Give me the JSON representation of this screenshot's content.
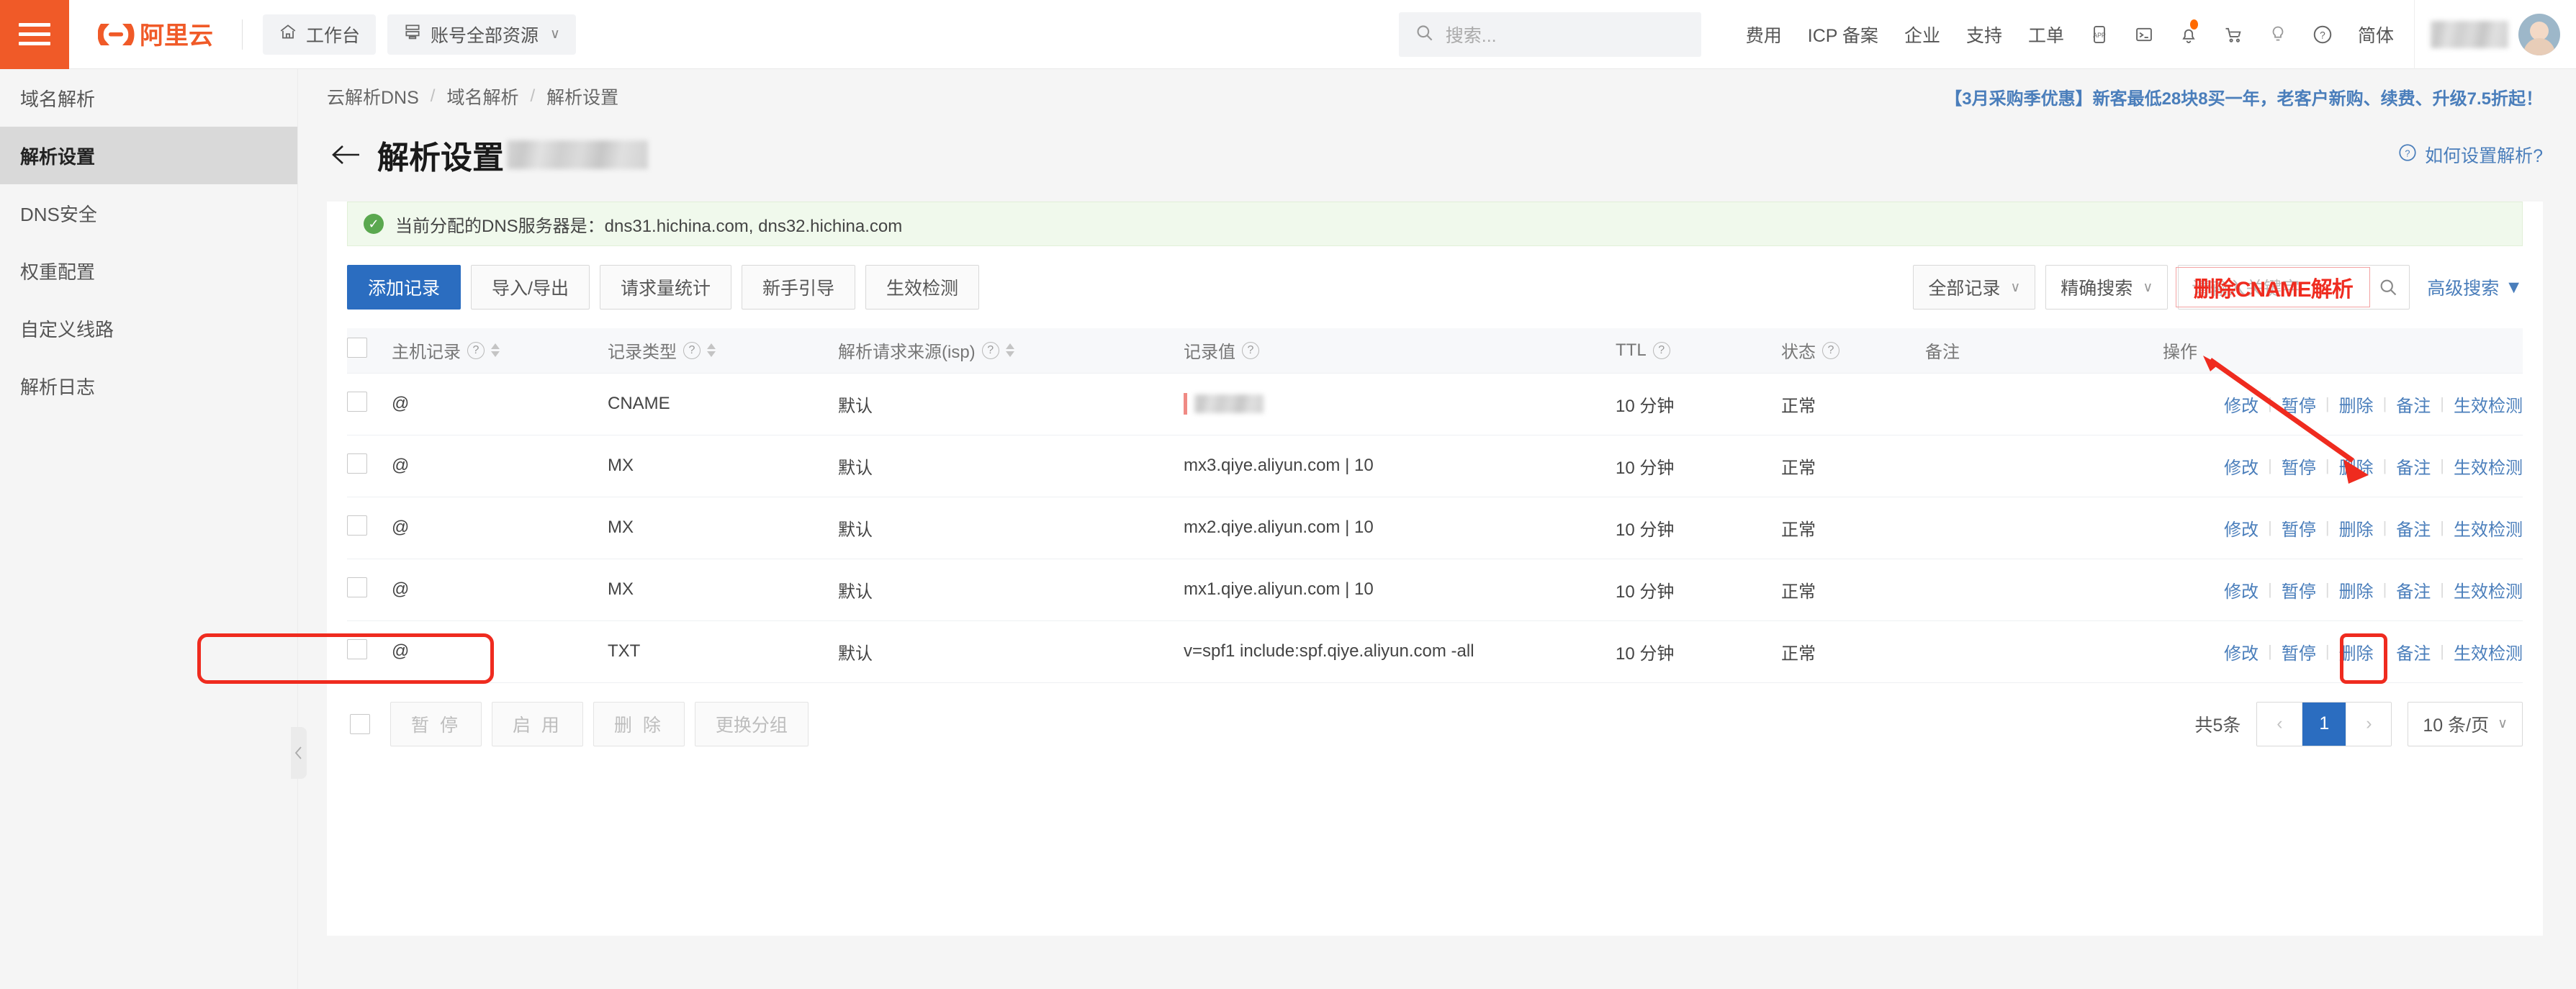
{
  "colors": {
    "brand_orange": "#f05a28",
    "primary_blue": "#2b6dc0",
    "link_blue": "#4a7ebb",
    "annotation_red": "#ef2b1f",
    "status_green": "#4caf50",
    "notice_bg": "#f0f9ec"
  },
  "header": {
    "menu_icon": "hamburger-icon",
    "logo_text": "阿里云",
    "workbench": {
      "label": "工作台",
      "icon": "home-icon"
    },
    "resources": {
      "label": "账号全部资源",
      "icon": "grid-icon",
      "caret": "∨"
    },
    "search": {
      "placeholder": "搜索...",
      "icon": "search-icon"
    },
    "links": [
      "费用",
      "ICP 备案",
      "企业",
      "支持",
      "工单"
    ],
    "icons": [
      "app-icon",
      "terminal-icon",
      "bell-icon",
      "cart-icon",
      "lightbulb-icon",
      "question-icon"
    ],
    "lang": "简体",
    "account_name_redacted": true
  },
  "sidebar": {
    "items": [
      {
        "label": "域名解析",
        "active": false
      },
      {
        "label": "解析设置",
        "active": true
      },
      {
        "label": "DNS安全",
        "active": false
      },
      {
        "label": "权重配置",
        "active": false
      },
      {
        "label": "自定义线路",
        "active": false
      },
      {
        "label": "解析日志",
        "active": false
      }
    ],
    "collapse_icon": "chevron-left-icon"
  },
  "breadcrumb": {
    "items": [
      "云解析DNS",
      "域名解析",
      "解析设置"
    ],
    "separator": "/"
  },
  "promo": "【3月采购季优惠】新客最低28块8买一年，老客户新购、续费、升级7.5折起！",
  "page": {
    "back_icon": "arrow-left-icon",
    "title": "解析设置",
    "title_domain_redacted": true,
    "help_link": {
      "label": "如何设置解析?",
      "icon": "question-circle-icon"
    }
  },
  "notice": {
    "icon": "check-circle-icon",
    "text": "当前分配的DNS服务器是：dns31.hichina.com, dns32.hichina.com"
  },
  "toolbar": {
    "add_record": "添加记录",
    "import_export": "导入/导出",
    "request_stats": "请求量统计",
    "beginner_guide": "新手引导",
    "effect_check": "生效检测",
    "filter_type": {
      "label": "全部记录",
      "caret": "∨"
    },
    "filter_match": {
      "label": "精确搜索",
      "caret": "∨"
    },
    "search": {
      "placeholder": "请输入关键字",
      "value": "",
      "icon": "search-icon"
    },
    "advanced_search": {
      "label": "高级搜索",
      "caret": "▼"
    }
  },
  "annotations": {
    "search_note": "删除CNAME解析",
    "arrow": "red-arrow-pointing-to-delete-link",
    "highlight_row": "row-1 host-and-type",
    "highlight_action": "row-1 delete-link"
  },
  "table": {
    "columns": [
      {
        "label": "主机记录",
        "help": true,
        "sortable": true
      },
      {
        "label": "记录类型",
        "help": true,
        "sortable": true
      },
      {
        "label": "解析请求来源(isp)",
        "help": true,
        "sortable": true
      },
      {
        "label": "记录值",
        "help": true,
        "sortable": false
      },
      {
        "label": "TTL",
        "help": true,
        "sortable": false
      },
      {
        "label": "状态",
        "help": true,
        "sortable": false
      },
      {
        "label": "备注",
        "help": false,
        "sortable": false
      },
      {
        "label": "操作",
        "help": false,
        "sortable": false
      }
    ],
    "row_actions": [
      "修改",
      "暂停",
      "删除",
      "备注",
      "生效检测"
    ],
    "rows": [
      {
        "host": "@",
        "type": "CNAME",
        "isp": "默认",
        "value": "",
        "value_redacted": true,
        "ttl": "10 分钟",
        "status": "正常",
        "remark": ""
      },
      {
        "host": "@",
        "type": "MX",
        "isp": "默认",
        "value": "mx3.qiye.aliyun.com | 10",
        "value_redacted": false,
        "ttl": "10 分钟",
        "status": "正常",
        "remark": ""
      },
      {
        "host": "@",
        "type": "MX",
        "isp": "默认",
        "value": "mx2.qiye.aliyun.com | 10",
        "value_redacted": false,
        "ttl": "10 分钟",
        "status": "正常",
        "remark": ""
      },
      {
        "host": "@",
        "type": "MX",
        "isp": "默认",
        "value": "mx1.qiye.aliyun.com | 10",
        "value_redacted": false,
        "ttl": "10 分钟",
        "status": "正常",
        "remark": ""
      },
      {
        "host": "@",
        "type": "TXT",
        "isp": "默认",
        "value": "v=spf1 include:spf.qiye.aliyun.com -all",
        "value_redacted": false,
        "ttl": "10 分钟",
        "status": "正常",
        "remark": ""
      }
    ]
  },
  "footer": {
    "bulk": [
      "暂 停",
      "启 用",
      "删 除",
      "更换分组"
    ],
    "total": "共5条",
    "prev": "‹",
    "page": "1",
    "next": "›",
    "page_size": {
      "label": "10 条/页",
      "caret": "∨"
    }
  }
}
